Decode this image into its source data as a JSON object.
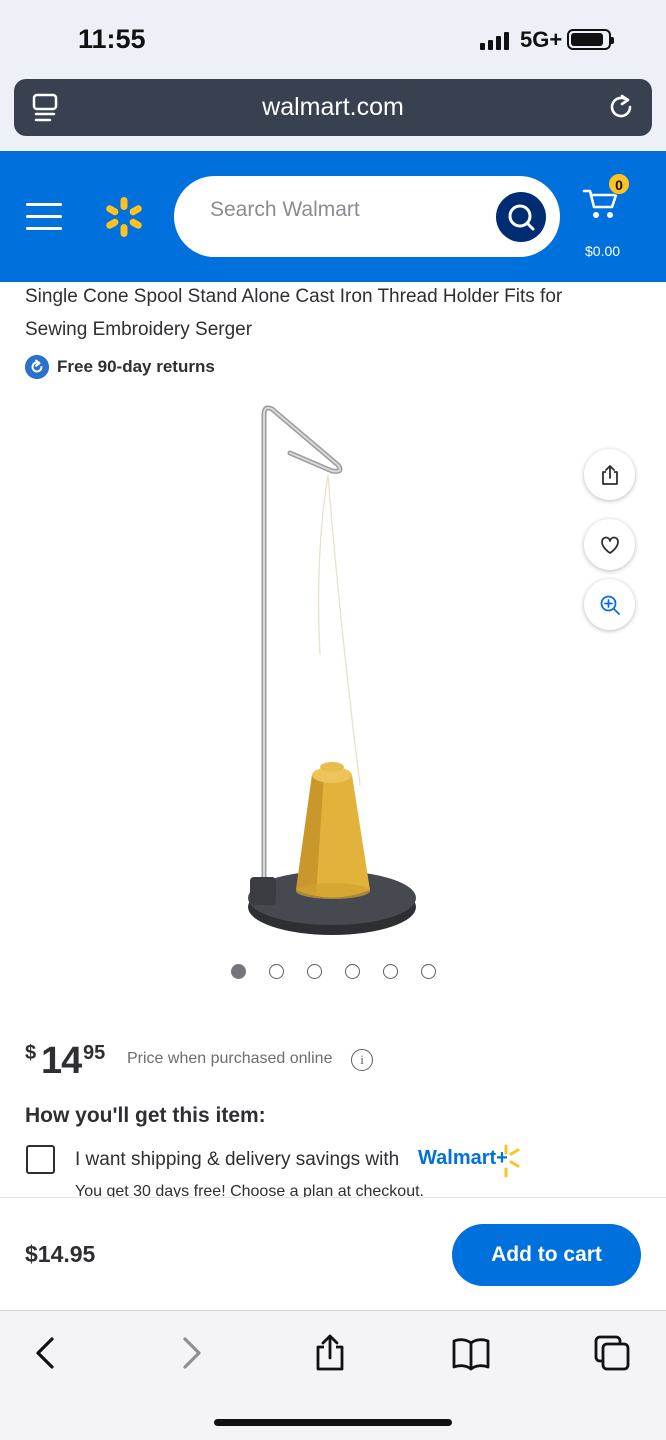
{
  "status_bar": {
    "time": "11:55",
    "network": "5G+",
    "battery_level": 0.9
  },
  "browser": {
    "url": "walmart.com",
    "reader_icon": "reader-icon",
    "reload_icon": "reload-icon"
  },
  "header": {
    "menu_icon": "hamburger-menu-icon",
    "logo": "walmart-spark-logo",
    "search_placeholder": "Search Walmart",
    "search_icon": "search-icon",
    "cart_count": "0",
    "cart_total": "$0.00",
    "brand_color": "#0071dc",
    "accent_color": "#ffc220"
  },
  "product": {
    "title": "Single Cone Spool Stand Alone Cast Iron Thread Holder Fits for Sewing Embroidery Serger",
    "returns_text": "Free 90-day returns",
    "image_alt": "Cone spool stand with yellow thread",
    "actions": [
      "share-icon",
      "heart-icon",
      "zoom-in-icon"
    ],
    "carousel": {
      "count": 6,
      "active": 0
    },
    "price": {
      "dollar": "$",
      "whole": "14",
      "cents": "95"
    },
    "price_note": "Price when purchased online",
    "fulfillment_heading": "How you'll get this item:",
    "walmart_plus_text": "I want shipping & delivery savings with",
    "walmart_plus_brand": "Walmart+",
    "walmart_plus_sub": "You get 30 days free! Choose a plan at checkout."
  },
  "sticky_bar": {
    "price": "$14.95",
    "add_to_cart": "Add to cart"
  },
  "safari_toolbar": [
    "back-icon",
    "forward-icon",
    "share-icon",
    "bookmarks-icon",
    "tabs-icon"
  ]
}
